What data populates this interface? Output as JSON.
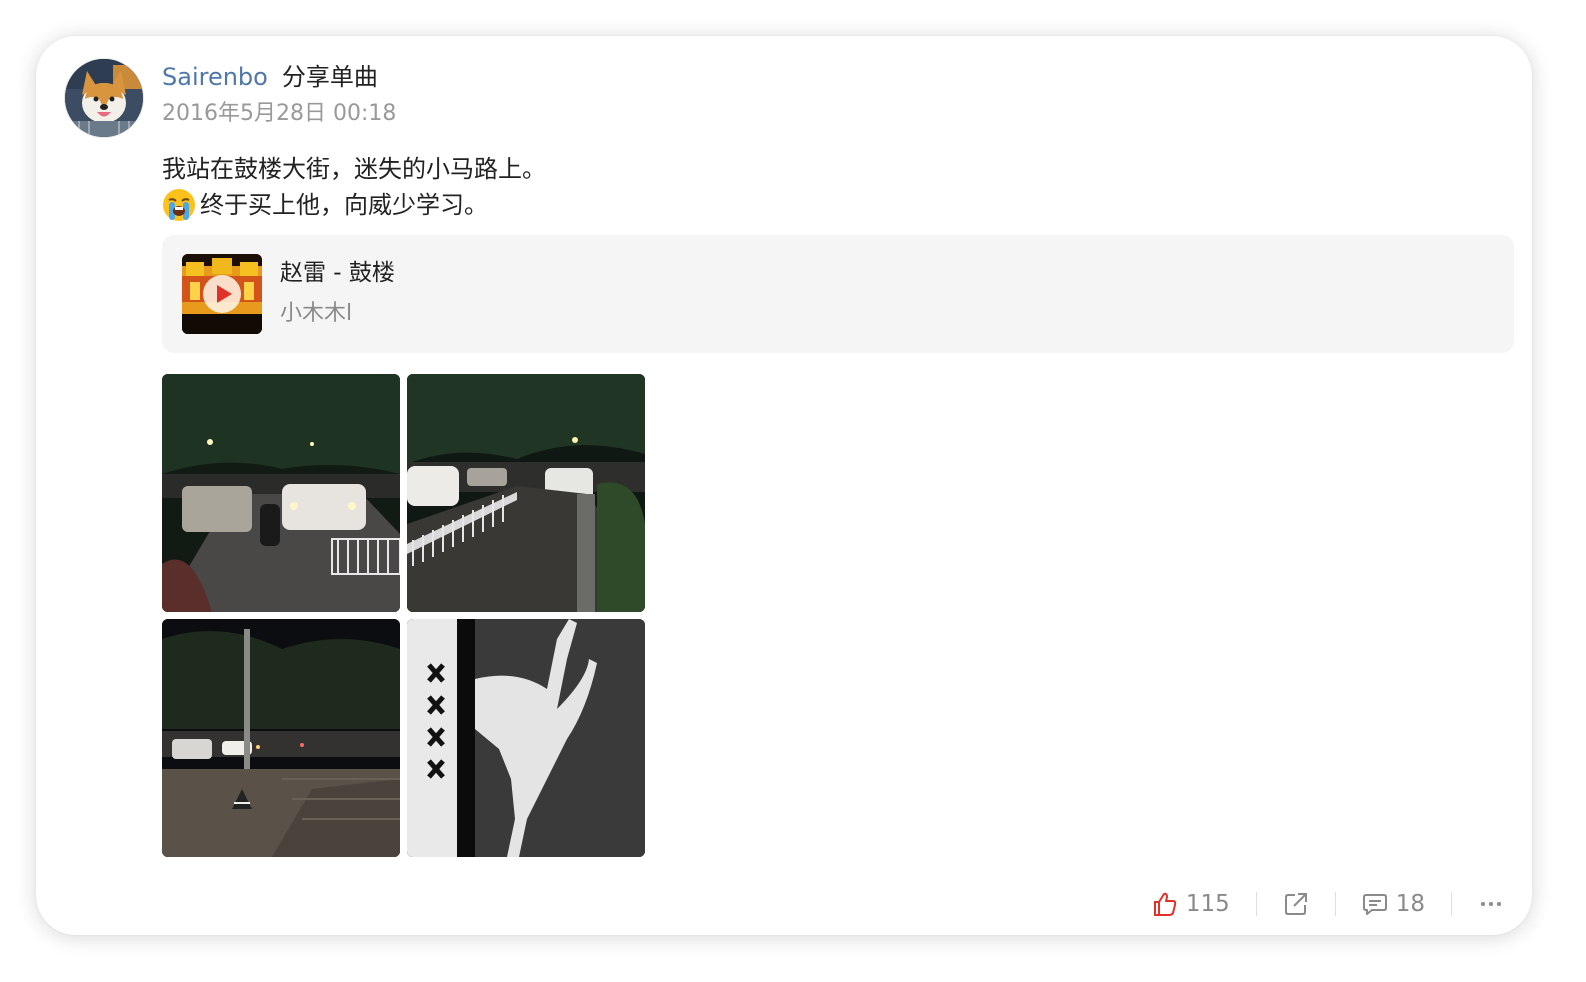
{
  "post": {
    "author": "Sairenbo",
    "action": "分享单曲",
    "timestamp": "2016年5月28日 00:18",
    "text_line1": "我站在鼓楼大街，迷失的小马路上。",
    "text_line2": "终于买上他，向威少学习。",
    "emoji": "loudly-crying-face"
  },
  "music": {
    "title": "赵雷 - 鼓楼",
    "subtitle": "小木木l",
    "cover_icon": "play-icon"
  },
  "photos": [
    "street-night-photo-1",
    "street-night-photo-2",
    "street-night-photo-3",
    "jordan-shoebox-photo"
  ],
  "actions": {
    "like_count": "115",
    "comment_count": "18",
    "like_color": "#e0322a"
  },
  "colors": {
    "username": "#5077aa",
    "timestamp": "#999999",
    "music_card_bg": "#f5f5f5"
  }
}
